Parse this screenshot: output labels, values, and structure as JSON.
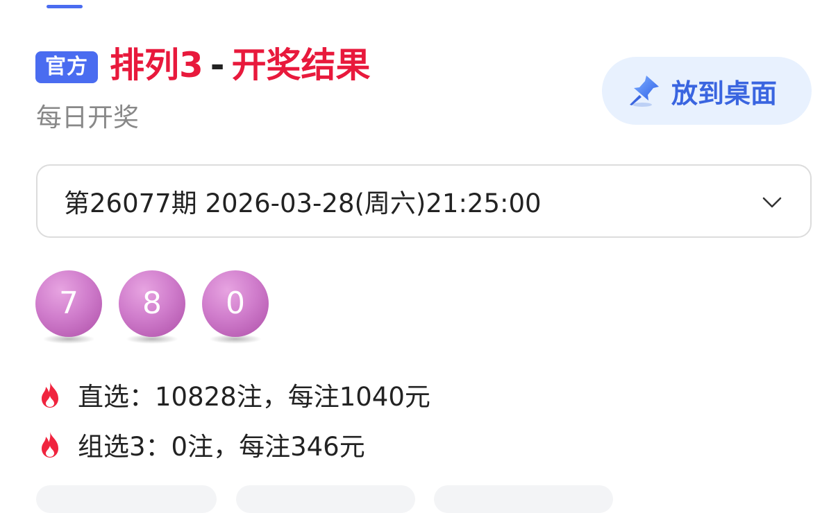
{
  "header": {
    "official_badge": "官方",
    "title_game": "排列3",
    "title_sep": "-",
    "title_suffix": "开奖结果",
    "subtitle": "每日开奖"
  },
  "pin_button": {
    "label": "放到桌面",
    "icon": "pin-icon"
  },
  "issue_select": {
    "value": "第26077期 2026-03-28(周六)21:25:00",
    "icon": "chevron-down-icon"
  },
  "numbers": [
    "7",
    "8",
    "0"
  ],
  "prizes": [
    {
      "text": "直选：10828注，每注1040元",
      "icon": "flame-icon"
    },
    {
      "text": "组选3：0注，每注346元",
      "icon": "flame-icon"
    }
  ],
  "colors": {
    "accent_blue": "#4a6cf0",
    "title_red": "#e8193c",
    "ball_purple": "#c56ec1",
    "pin_button_bg": "#e8f1fe"
  }
}
